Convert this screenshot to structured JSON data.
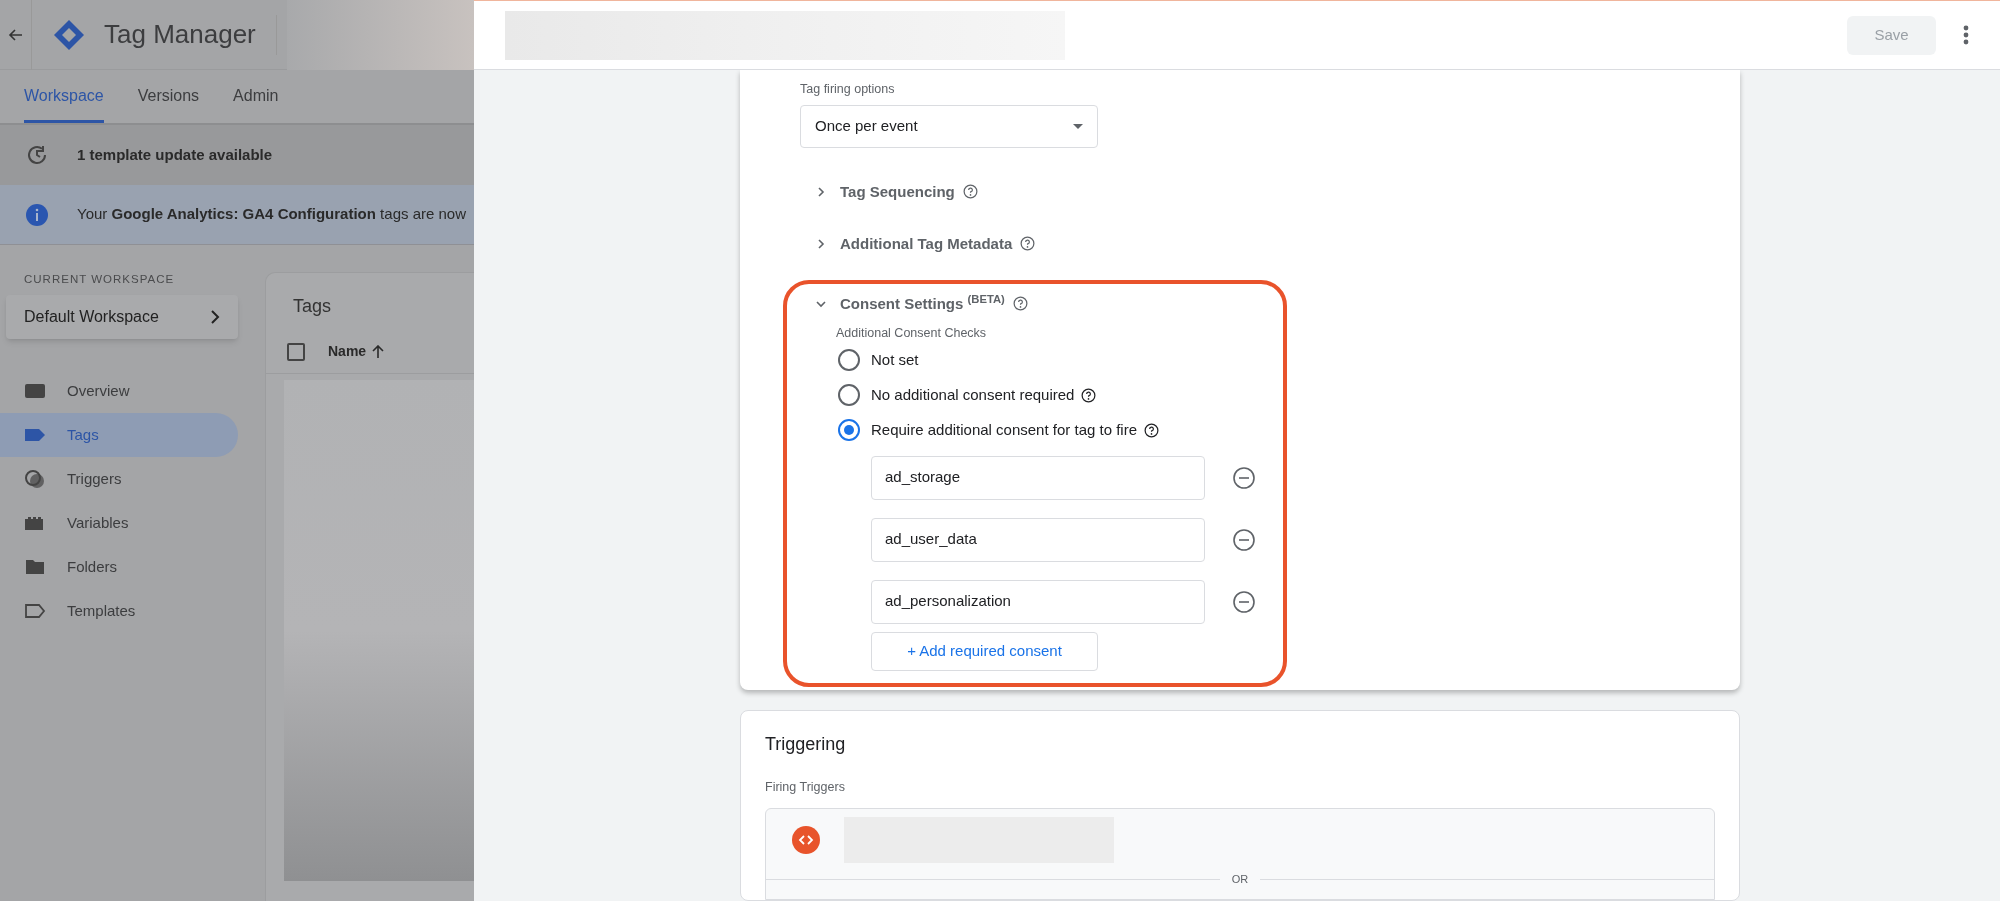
{
  "app": {
    "title": "Tag Manager"
  },
  "nav_tabs": [
    {
      "label": "Workspace",
      "selected": true
    },
    {
      "label": "Versions",
      "selected": false
    },
    {
      "label": "Admin",
      "selected": false
    }
  ],
  "update_bar": {
    "text": "1 template update available"
  },
  "info_bar": {
    "text": "Your **Google Analytics: GA4 Configuration** tags are now"
  },
  "workspace": {
    "label": "CURRENT WORKSPACE",
    "name": "Default Workspace"
  },
  "sidebar": {
    "items": [
      {
        "label": "Overview",
        "kind": "overview",
        "selected": false
      },
      {
        "label": "Tags",
        "kind": "tags",
        "selected": true
      },
      {
        "label": "Triggers",
        "kind": "triggers",
        "selected": false
      },
      {
        "label": "Variables",
        "kind": "variables",
        "selected": false
      },
      {
        "label": "Folders",
        "kind": "folders",
        "selected": false
      },
      {
        "label": "Templates",
        "kind": "templates",
        "selected": false
      }
    ]
  },
  "tags_panel": {
    "title": "Tags",
    "select_all": {
      "checked": false
    },
    "columns": [
      "Name"
    ]
  },
  "editor": {
    "save": {
      "label": "Save",
      "disabled": true
    }
  },
  "firing_options": {
    "label": "Tag firing options",
    "value": "Once per event"
  },
  "sections": [
    {
      "title": "Tag Sequencing",
      "expanded": false
    },
    {
      "title": "Additional Tag Metadata",
      "expanded": false
    },
    {
      "title": "Consent Settings $^{(BETA)}$",
      "expanded": true
    }
  ],
  "consent": {
    "label": "Additional Consent Checks",
    "options": [
      {
        "label": "Not set",
        "help": false,
        "selected": false
      },
      {
        "label": "No additional consent required",
        "help": true,
        "selected": false
      },
      {
        "label": "Require additional consent for tag to fire",
        "help": true,
        "selected": true
      }
    ],
    "types": [
      "ad_storage",
      "ad_user_data",
      "ad_personalization"
    ],
    "add_button": "+ Add required consent"
  },
  "triggering": {
    "title": "Triggering",
    "label": "Firing Triggers",
    "separator": "OR"
  }
}
